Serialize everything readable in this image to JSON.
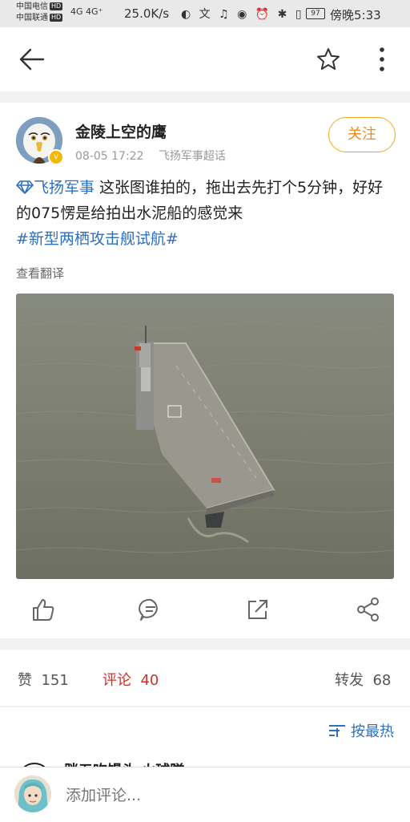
{
  "status_bar": {
    "carrier1": "中国电信",
    "carrier2": "中国联通",
    "hd": "HD",
    "signal": "4G 4G⁺",
    "speed": "25.0K/s",
    "battery": "97",
    "time": "傍晚5:33"
  },
  "header": {
    "back_icon": "back-arrow-icon",
    "star_icon": "star-icon",
    "more_icon": "more-vertical-icon"
  },
  "post": {
    "author": "金陵上空的鹰",
    "date": "08-05 17:22",
    "source": "飞扬军事超话",
    "follow_label": "关注",
    "topic": "飞扬军事",
    "text": " 这张图谁拍的，拖出去先打个5分钟，好好的075愣是给拍出水泥船的感觉来",
    "hashtag": "#新型两栖攻击舰试航#",
    "translate_label": "查看翻译"
  },
  "stats": {
    "like_label": "赞",
    "like_count": "151",
    "comment_label": "评论",
    "comment_count": "40",
    "repost_label": "转发",
    "repost_count": "68"
  },
  "sort": {
    "label": "按最热"
  },
  "comment_peek": {
    "text": "胖五吃馒头 火球隊"
  },
  "comment_input": {
    "placeholder": "添加评论..."
  },
  "colors": {
    "link_blue": "#2e6fbf",
    "follow_orange": "#f08a1a",
    "comment_red": "#d0302b"
  }
}
